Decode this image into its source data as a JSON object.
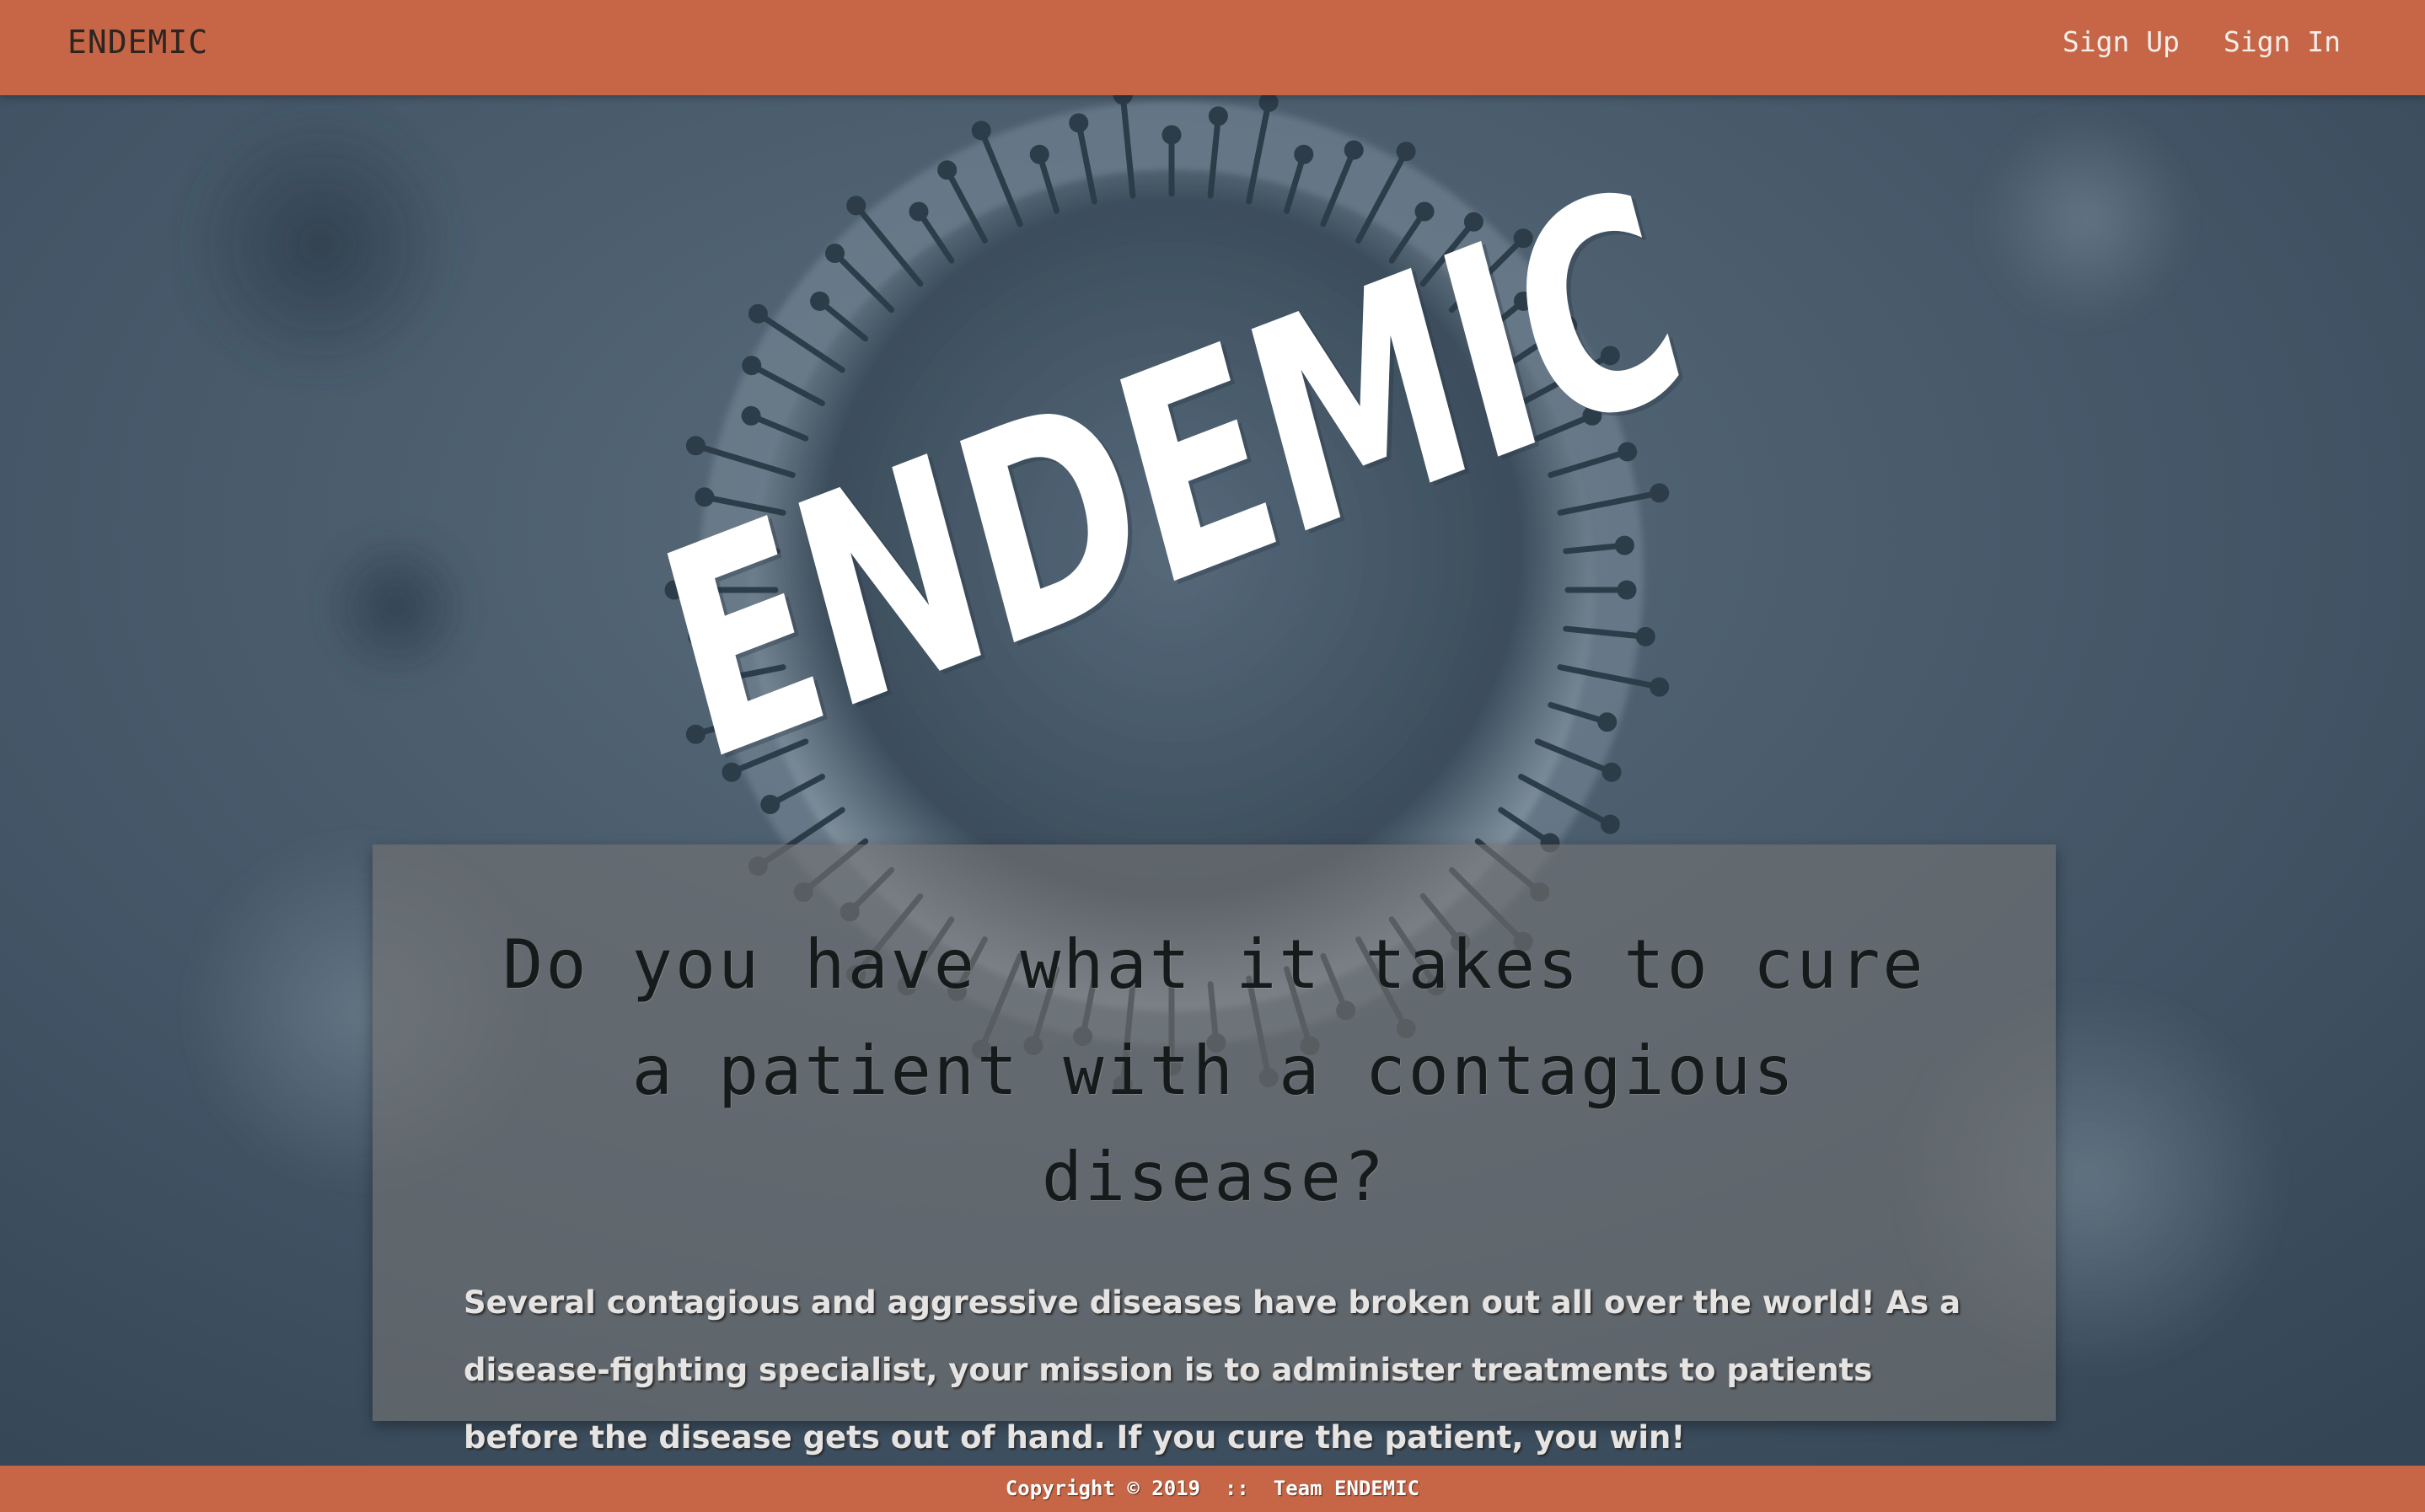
{
  "navbar": {
    "brand": "ENDEMIC",
    "links": [
      {
        "label": "Sign Up"
      },
      {
        "label": "Sign In"
      }
    ]
  },
  "hero": {
    "logo_text": "ENDEMIC"
  },
  "card": {
    "heading": "Do you have what it takes to cure a patient with a contagious disease?",
    "body": "Several contagious and aggressive diseases have broken out all over the world! As a disease-fighting specialist, your mission is to administer treatments to patients before the disease gets out of hand. If you cure the patient, you win!"
  },
  "footer": {
    "copyright": "Copyright © 2019  ::  Team ENDEMIC"
  },
  "colors": {
    "accent": "#c66646",
    "background": "#3d5060",
    "card": "#737373"
  }
}
